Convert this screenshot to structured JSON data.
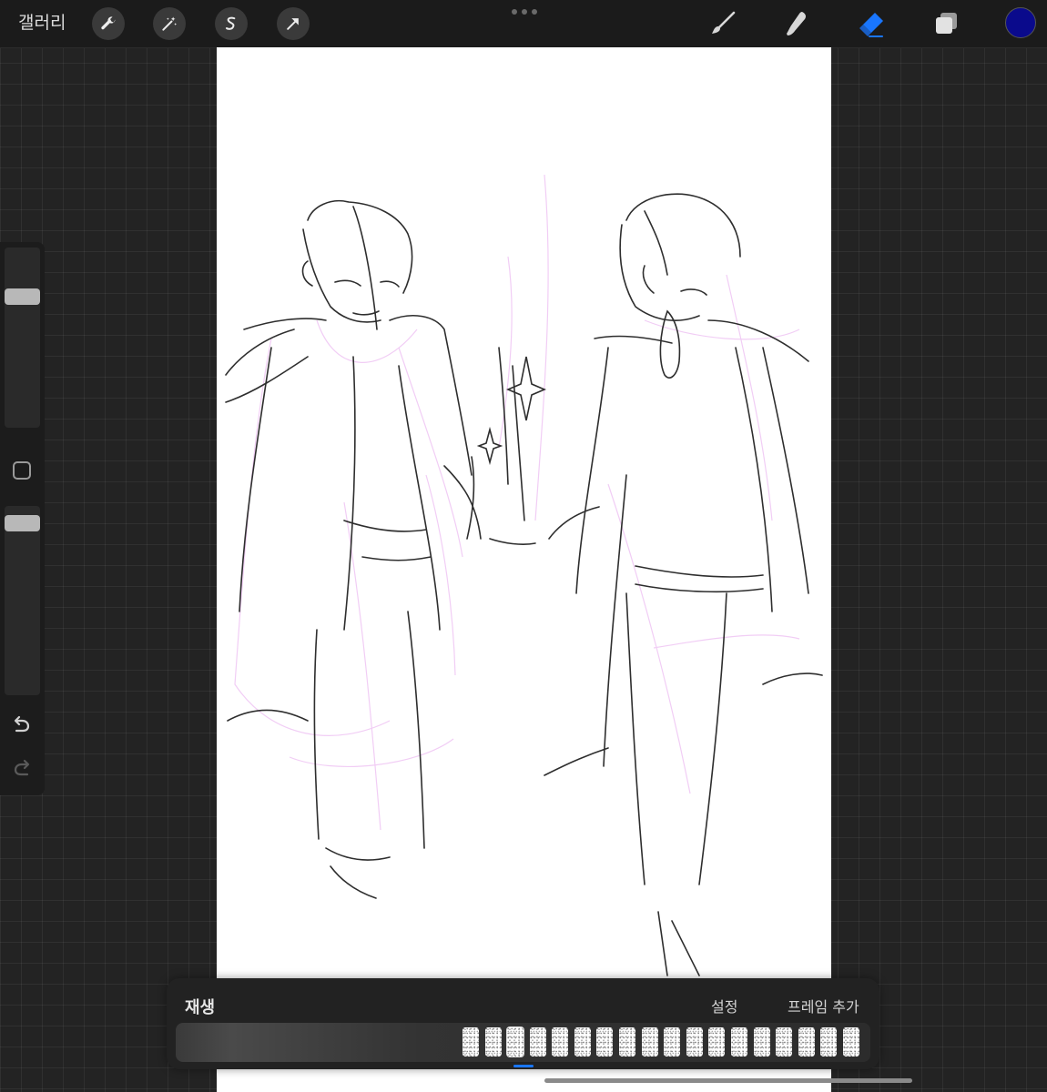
{
  "topbar": {
    "gallery_label": "갤러리",
    "left_tools": [
      "wrench-icon",
      "magic-wand-icon",
      "selection-s-icon",
      "transform-arrow-icon"
    ],
    "right_tools": [
      "brush-icon",
      "smudge-icon",
      "eraser-icon",
      "layers-icon"
    ],
    "active_tool": "eraser-icon",
    "current_color": "#0a0a8c",
    "accent_color": "#1976ff"
  },
  "sidebar": {
    "size_slider_value": 0.75,
    "opacity_slider_value": 0.95
  },
  "animation_panel": {
    "play_label": "재생",
    "settings_label": "설정",
    "add_frame_label": "프레임 추가",
    "frame_count": 18,
    "selected_frame": 3
  }
}
